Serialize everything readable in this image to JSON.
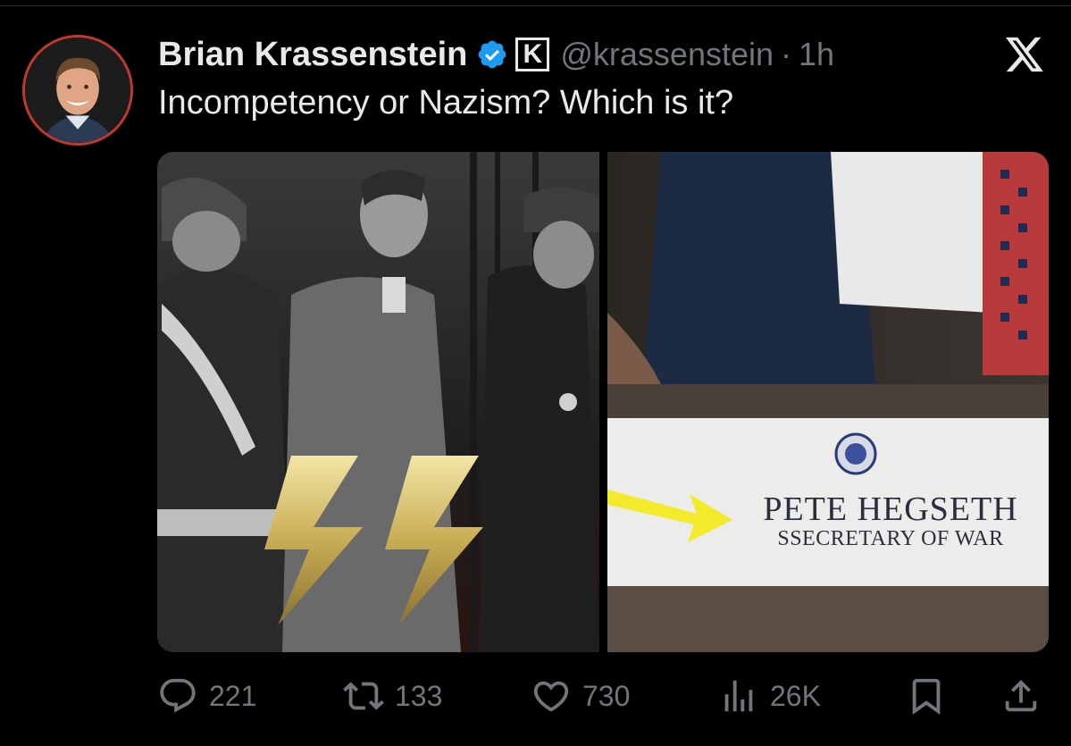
{
  "tweet": {
    "author_name": "Brian Krassenstein",
    "affiliate_badge_letter": "K",
    "handle": "@krassenstein",
    "separator": "·",
    "time": "1h",
    "text": "Incompetency or Nazism? Which is it?"
  },
  "media": {
    "right_image": {
      "nameplate_name": "PETE HEGSETH",
      "nameplate_title": "SSECRETARY OF WAR"
    }
  },
  "actions": {
    "replies": "221",
    "reposts": "133",
    "likes": "730",
    "views": "26K"
  },
  "colors": {
    "background": "#000000",
    "text_primary": "#e7e9ea",
    "text_secondary": "#71767b",
    "verified_blue": "#1d9bf0",
    "avatar_ring": "#c0392b"
  },
  "icons": [
    "x-logo-icon",
    "verified-badge-icon",
    "reply-icon",
    "repost-icon",
    "like-icon",
    "views-icon",
    "bookmark-icon",
    "share-icon"
  ]
}
